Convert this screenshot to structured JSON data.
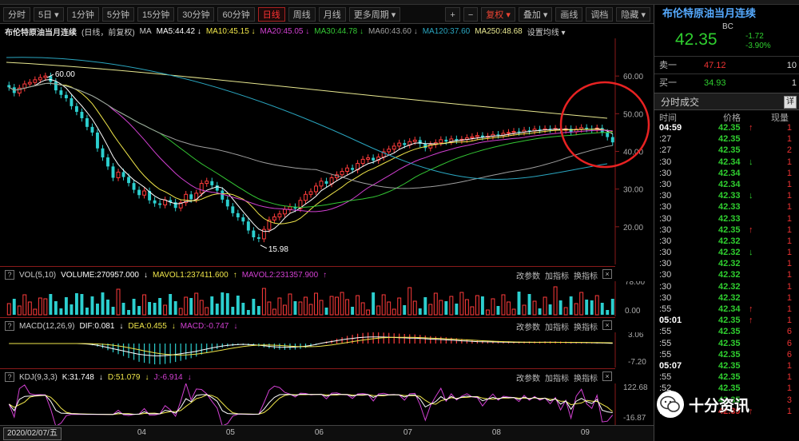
{
  "toolbar": {
    "periods": [
      "分时",
      "5日",
      "1分钟",
      "5分钟",
      "15分钟",
      "30分钟",
      "60分钟",
      "日线",
      "周线",
      "月线",
      "更多周期"
    ],
    "active_period": "日线",
    "right_buttons": [
      "+",
      "−",
      "复权",
      "叠加",
      "画线",
      "调档",
      "隐藏"
    ]
  },
  "chart_header": {
    "title": "布伦特原油当月连续",
    "mode": "(日线，前复权)",
    "ma_label": "MA",
    "ma": [
      {
        "label": "MA5:44.42",
        "color": "#ffffff",
        "arrow": "↓"
      },
      {
        "label": "MA10:45.15",
        "color": "#f0e64a",
        "arrow": "↓"
      },
      {
        "label": "MA20:45.05",
        "color": "#d240d2",
        "arrow": "↓"
      },
      {
        "label": "MA30:44.78",
        "color": "#34c734",
        "arrow": "↓"
      },
      {
        "label": "MA60:43.60",
        "color": "#a0a0a0",
        "arrow": "↓"
      },
      {
        "label": "MA120:37.60",
        "color": "#2aa6c0",
        "arrow": ""
      },
      {
        "label": "MA250:48.68",
        "color": "#e8e890",
        "arrow": ""
      }
    ],
    "settings": "设置均线"
  },
  "price_axis": [
    "60.00",
    "50.00",
    "40.00",
    "30.00",
    "20.00"
  ],
  "annotations": {
    "high": "60.00",
    "low": "15.98"
  },
  "month_axis": [
    "04",
    "05",
    "06",
    "07",
    "08",
    "09"
  ],
  "volume_panel": {
    "label": "VOL(5,10)",
    "volume": "VOLUME:270957.000",
    "mavol1": "MAVOL1:237411.600",
    "mavol2": "MAVOL2:231357.900",
    "axis": [
      "78.00",
      "0.00"
    ]
  },
  "macd_panel": {
    "label": "MACD(12,26,9)",
    "dif": "DIF:0.081",
    "dea": "DEA:0.455",
    "macd": "MACD:-0.747",
    "axis": [
      "3.06",
      "-7.20"
    ]
  },
  "kdj_panel": {
    "label": "KDJ(9,3,3)",
    "k": "K:31.748",
    "d": "D:51.079",
    "j": "J:-6.914",
    "axis": [
      "122.68",
      "-16.87"
    ]
  },
  "panel_buttons": [
    "改参数",
    "加指标",
    "换指标"
  ],
  "bottom_bar": {
    "date": "2020/02/07/五"
  },
  "quote": {
    "name": "布伦特原油当月连续",
    "code": "BC",
    "price": "42.35",
    "change": "-1.72",
    "change_pct": "-3.90%",
    "ask_label": "卖一",
    "ask_price": "47.12",
    "ask_qty": "10",
    "bid_label": "买一",
    "bid_price": "34.93",
    "bid_qty": "1",
    "section": "分时成交",
    "detail": "详",
    "col_time": "时间",
    "col_price": "价格",
    "col_vol": "现量"
  },
  "ticks": [
    {
      "t": "04:59",
      "p": "42.35",
      "a": "↑",
      "v": "1",
      "bold": true
    },
    {
      "t": ":27",
      "p": "42.35",
      "a": "",
      "v": "1"
    },
    {
      "t": ":27",
      "p": "42.35",
      "a": "",
      "v": "2"
    },
    {
      "t": ":30",
      "p": "42.34",
      "a": "↓",
      "v": "1"
    },
    {
      "t": ":30",
      "p": "42.34",
      "a": "",
      "v": "1"
    },
    {
      "t": ":30",
      "p": "42.34",
      "a": "",
      "v": "1"
    },
    {
      "t": ":30",
      "p": "42.33",
      "a": "↓",
      "v": "1"
    },
    {
      "t": ":30",
      "p": "42.33",
      "a": "",
      "v": "1"
    },
    {
      "t": ":30",
      "p": "42.33",
      "a": "",
      "v": "1"
    },
    {
      "t": ":30",
      "p": "42.35",
      "a": "↑",
      "v": "1"
    },
    {
      "t": ":30",
      "p": "42.32",
      "a": "",
      "v": "1"
    },
    {
      "t": ":30",
      "p": "42.32",
      "a": "↓",
      "v": "1"
    },
    {
      "t": ":30",
      "p": "42.32",
      "a": "",
      "v": "1"
    },
    {
      "t": ":30",
      "p": "42.32",
      "a": "",
      "v": "1"
    },
    {
      "t": ":30",
      "p": "42.32",
      "a": "",
      "v": "1"
    },
    {
      "t": ":30",
      "p": "42.32",
      "a": "",
      "v": "1"
    },
    {
      "t": ":55",
      "p": "42.34",
      "a": "↑",
      "v": "1"
    },
    {
      "t": "05:01",
      "p": "42.35",
      "a": "↑",
      "v": "1",
      "bold": true
    },
    {
      "t": ":55",
      "p": "42.35",
      "a": "",
      "v": "6"
    },
    {
      "t": ":55",
      "p": "42.35",
      "a": "",
      "v": "6"
    },
    {
      "t": ":55",
      "p": "42.35",
      "a": "",
      "v": "6"
    },
    {
      "t": "05:07",
      "p": "42.35",
      "a": "",
      "v": "1",
      "bold": true
    },
    {
      "t": ":55",
      "p": "42.35",
      "a": "",
      "v": "1"
    },
    {
      "t": ":52",
      "p": "42.35",
      "a": "",
      "v": "1"
    },
    {
      "t": ":55",
      "p": "42.35",
      "a": "",
      "v": "3"
    },
    {
      "t": ":55",
      "p": "42.39",
      "a": "↑",
      "v": "1",
      "red": true
    }
  ],
  "watermark": "十分资讯",
  "chart_data": {
    "type": "candlestick",
    "title": "布伦特原油当月连续",
    "months": [
      "04",
      "05",
      "06",
      "07",
      "08",
      "09"
    ],
    "ylim": [
      10,
      70
    ],
    "closes": [
      57.0,
      55.5,
      56.8,
      57.9,
      58.3,
      59.0,
      59.6,
      60.0,
      58.5,
      56.2,
      55.0,
      54.1,
      52.0,
      50.5,
      48.8,
      46.5,
      45.0,
      40.8,
      38.4,
      36.0,
      33.0,
      34.5,
      33.2,
      31.6,
      29.8,
      28.4,
      29.5,
      27.0,
      26.2,
      25.8,
      27.1,
      26.5,
      25.0,
      26.4,
      28.6,
      27.3,
      28.9,
      31.5,
      32.1,
      31.0,
      29.6,
      27.2,
      25.4,
      23.6,
      22.5,
      21.4,
      19.0,
      17.2,
      16.8,
      19.3,
      21.8,
      22.6,
      23.4,
      24.6,
      25.3,
      24.8,
      27.0,
      28.6,
      29.3,
      30.8,
      32.1,
      31.4,
      33.0,
      33.8,
      34.7,
      35.6,
      35.1,
      36.8,
      37.9,
      38.3,
      37.6,
      38.5,
      39.9,
      40.6,
      41.4,
      42.2,
      41.7,
      42.6,
      43.0,
      42.0,
      40.9,
      41.8,
      42.3,
      43.1,
      42.6,
      43.3,
      42.9,
      43.2,
      43.6,
      43.9,
      44.2,
      43.8,
      44.0,
      44.5,
      44.3,
      44.8,
      45.0,
      45.3,
      45.1,
      45.6,
      45.4,
      45.9,
      45.7,
      46.0,
      45.8,
      46.1,
      45.6,
      46.0,
      45.2,
      45.9,
      46.3,
      46.0,
      45.8,
      46.2,
      45.0,
      43.8,
      42.4
    ]
  }
}
